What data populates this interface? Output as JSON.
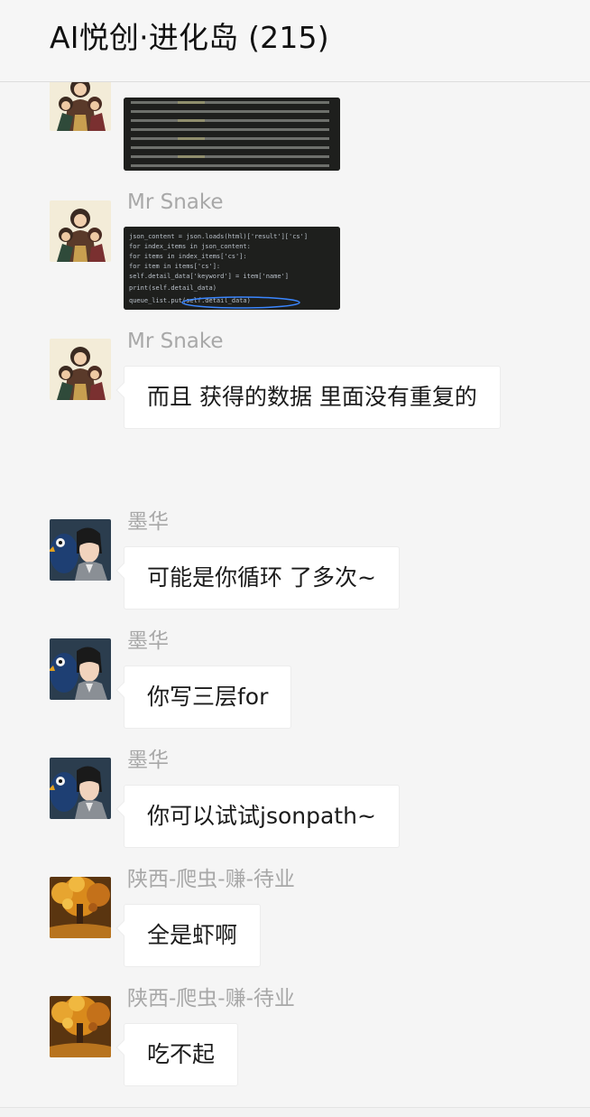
{
  "header": {
    "title": "AI悦创·进化岛 (215)"
  },
  "messages": [
    {
      "sender": "",
      "avatar": "anime-group-avatar",
      "type": "image"
    },
    {
      "sender": "Mr Snake",
      "avatar": "anime-group-avatar",
      "type": "image",
      "code_lines": [
        "json_content = json.loads(html)['result']['cs']",
        "for index_items in json_content:",
        "    for items in index_items['cs']:",
        "        for item in items['cs']:",
        "            self.detail_data['keyword'] = item['name']",
        "            print(self.detail_data)",
        "            queue_list.put(self.detail_data)"
      ]
    },
    {
      "sender": "Mr Snake",
      "avatar": "anime-group-avatar",
      "type": "text",
      "text": "而且 获得的数据 里面没有重复的"
    },
    {
      "sender": "墨华",
      "avatar": "anime-boy-bird-avatar",
      "type": "text",
      "text": "可能是你循环 了多次~"
    },
    {
      "sender": "墨华",
      "avatar": "anime-boy-bird-avatar",
      "type": "text",
      "text": "你写三层for"
    },
    {
      "sender": "墨华",
      "avatar": "anime-boy-bird-avatar",
      "type": "text",
      "text": "你可以试试jsonpath~"
    },
    {
      "sender": "陕西-爬虫-赚-待业",
      "avatar": "autumn-tree-avatar",
      "type": "text",
      "text": "全是虾啊"
    },
    {
      "sender": "陕西-爬虫-赚-待业",
      "avatar": "autumn-tree-avatar",
      "type": "text",
      "text": "吃不起"
    }
  ],
  "colors": {
    "background": "#f5f5f5",
    "bubble": "#ffffff",
    "sender": "#a8a8a8",
    "code_bg": "#1e1f1d"
  }
}
